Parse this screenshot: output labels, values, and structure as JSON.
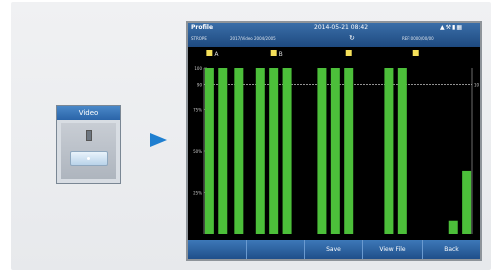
{
  "video_widget": {
    "title": "Video"
  },
  "device": {
    "header": {
      "title": "Profile",
      "datetime": "2014-05-21 08:42",
      "sub_left": "STROPE",
      "sub_mid": "2017/Video  2004/2005",
      "sub_right": "REF:0000/00/00"
    },
    "footer": {
      "buttons": [
        "",
        "",
        "Save",
        "View File",
        "Back"
      ]
    }
  },
  "chart_data": {
    "type": "bar",
    "y_tick_labels": [
      "100",
      "90",
      "75%",
      "50%",
      "25%"
    ],
    "y_ticks": [
      100,
      90,
      75,
      50,
      25
    ],
    "right_label": "10",
    "threshold_y": 90,
    "ylim": [
      0,
      100
    ],
    "marker_labels": [
      "A",
      "B"
    ],
    "colors": {
      "bar": "#4cbf3a",
      "marker": "#f5e05a",
      "line": "#bfbfbf"
    },
    "bars": [
      {
        "x": 0.02,
        "value": 100
      },
      {
        "x": 0.07,
        "value": 100
      },
      {
        "x": 0.13,
        "value": 100
      },
      {
        "x": 0.21,
        "value": 100
      },
      {
        "x": 0.26,
        "value": 100
      },
      {
        "x": 0.31,
        "value": 100
      },
      {
        "x": 0.44,
        "value": 100
      },
      {
        "x": 0.49,
        "value": 100
      },
      {
        "x": 0.54,
        "value": 100
      },
      {
        "x": 0.69,
        "value": 100
      },
      {
        "x": 0.74,
        "value": 100
      },
      {
        "x": 0.93,
        "value": 8
      },
      {
        "x": 0.98,
        "value": 38
      }
    ],
    "markers": [
      {
        "x": 0.02,
        "label": "A"
      },
      {
        "x": 0.26,
        "label": "B"
      },
      {
        "x": 0.54,
        "label": ""
      },
      {
        "x": 0.79,
        "label": ""
      }
    ]
  }
}
